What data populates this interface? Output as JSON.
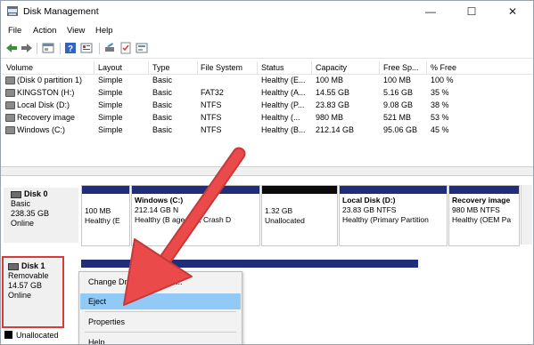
{
  "window": {
    "title": "Disk Management"
  },
  "menu": [
    "File",
    "Action",
    "View",
    "Help"
  ],
  "table": {
    "headers": [
      "Volume",
      "Layout",
      "Type",
      "File System",
      "Status",
      "Capacity",
      "Free Sp...",
      "% Free"
    ],
    "rows": [
      [
        "(Disk 0 partition 1)",
        "Simple",
        "Basic",
        "",
        "Healthy (E...",
        "100 MB",
        "100 MB",
        "100 %"
      ],
      [
        "KINGSTON (H:)",
        "Simple",
        "Basic",
        "FAT32",
        "Healthy (A...",
        "14.55 GB",
        "5.16 GB",
        "35 %"
      ],
      [
        "Local Disk (D:)",
        "Simple",
        "Basic",
        "NTFS",
        "Healthy (P...",
        "23.83 GB",
        "9.08 GB",
        "38 %"
      ],
      [
        "Recovery image",
        "Simple",
        "Basic",
        "NTFS",
        "Healthy (...",
        "980 MB",
        "521 MB",
        "53 %"
      ],
      [
        "Windows (C:)",
        "Simple",
        "Basic",
        "NTFS",
        "Healthy (B...",
        "212.14 GB",
        "95.06 GB",
        "45 %"
      ]
    ]
  },
  "disk0": {
    "title": "Disk 0",
    "type": "Basic",
    "size": "238.35 GB",
    "status": "Online",
    "partitions": [
      {
        "name": "",
        "size": "100 MB",
        "status": "Healthy (E"
      },
      {
        "name": "Windows  (C:)",
        "size": "212.14 GB N",
        "status": "Healthy (B   age File, Crash D"
      },
      {
        "name": "",
        "size": "1.32 GB",
        "status": "Unallocated"
      },
      {
        "name": "Local Disk  (D:)",
        "size": "23.83 GB NTFS",
        "status": "Healthy (Primary Partition"
      },
      {
        "name": "Recovery image",
        "size": "980 MB NTFS",
        "status": "Healthy (OEM Pa"
      }
    ]
  },
  "disk1": {
    "title": "Disk 1",
    "type": "Removable",
    "size": "14.57 GB",
    "status": "Online"
  },
  "legend": {
    "unallocated": "Unallocated"
  },
  "context_menu": {
    "items": [
      "Change Drive   and Paths...",
      "Eject",
      "Properties",
      "Help"
    ],
    "highlighted": "Eject"
  },
  "colors": {
    "partition_bar": "#1f2d7a",
    "highlight": "#91c9f7",
    "arrow": "#e84545",
    "callout_box": "#d63a3a"
  }
}
